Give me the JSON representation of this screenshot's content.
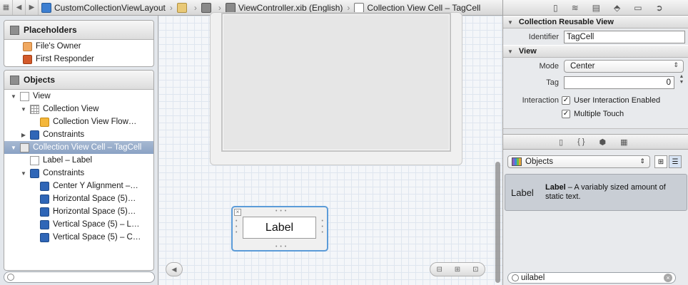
{
  "jumpbar": {
    "segments": [
      "CustomCollectionViewLayout",
      "ViewController.xib (English)",
      "Collection View Cell – TagCell"
    ]
  },
  "outline": {
    "placeholders_title": "Placeholders",
    "placeholders": [
      "File's Owner",
      "First Responder"
    ],
    "objects_title": "Objects",
    "objects": [
      {
        "label": "View",
        "icon": "view-icon"
      },
      {
        "label": "Collection View",
        "icon": "collection-view-icon"
      },
      {
        "label": "Collection View Flow…",
        "icon": "flow-layout-icon"
      },
      {
        "label": "Constraints",
        "icon": "constraints-icon"
      },
      {
        "label": "Collection View Cell – TagCell",
        "icon": "cell-icon"
      },
      {
        "label": "Label – Label",
        "icon": "label-icon"
      },
      {
        "label": "Constraints",
        "icon": "constraints-icon"
      },
      {
        "label": "Center Y Alignment –…",
        "icon": "constraint-icon"
      },
      {
        "label": "Horizontal Space (5)…",
        "icon": "constraint-icon"
      },
      {
        "label": "Horizontal Space (5)…",
        "icon": "constraint-icon"
      },
      {
        "label": "Vertical Space (5) – L…",
        "icon": "constraint-icon"
      },
      {
        "label": "Vertical Space (5) – C…",
        "icon": "constraint-icon"
      }
    ]
  },
  "canvas": {
    "cell_label": "Label"
  },
  "inspector": {
    "reusable_title": "Collection Reusable View",
    "identifier_label": "Identifier",
    "identifier_value": "TagCell",
    "view_title": "View",
    "mode_label": "Mode",
    "mode_value": "Center",
    "tag_label": "Tag",
    "tag_value": "0",
    "interaction_label": "Interaction",
    "user_interaction": "User Interaction Enabled",
    "multiple_touch": "Multiple Touch"
  },
  "library": {
    "selector_value": "Objects",
    "item_icon_text": "Label",
    "item_title": "Label",
    "item_desc": " – A variably sized amount of static text.",
    "search_value": "uilabel"
  }
}
